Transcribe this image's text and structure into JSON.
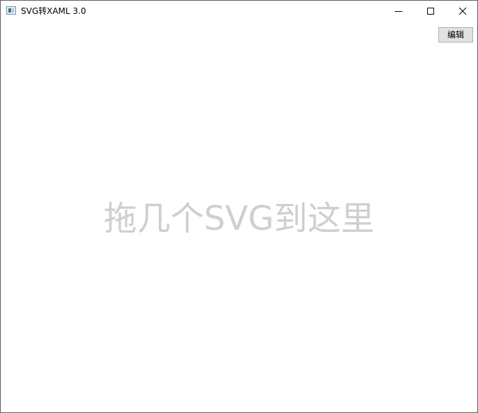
{
  "window": {
    "title": "SVG转XAML 3.0",
    "app_icon": "svg-window-icon",
    "controls": {
      "minimize_icon": "minimize-icon",
      "maximize_icon": "maximize-icon",
      "close_icon": "close-icon"
    }
  },
  "toolbar": {
    "edit_label": "编辑"
  },
  "main": {
    "drop_hint": "拖几个SVG到这里"
  },
  "colors": {
    "hint_text": "#cfcfcf",
    "button_bg": "#e1e1e1",
    "button_border": "#adadad"
  }
}
